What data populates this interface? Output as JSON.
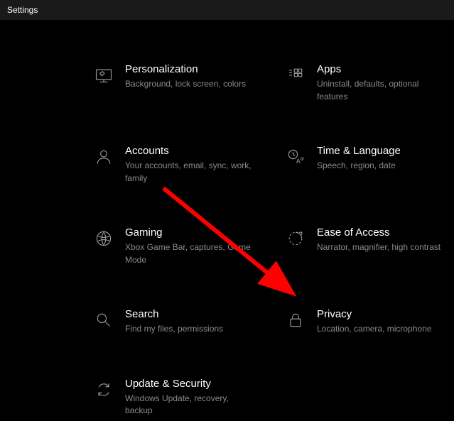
{
  "window": {
    "title": "Settings"
  },
  "items": [
    {
      "title": "Personalization",
      "desc": "Background, lock screen, colors"
    },
    {
      "title": "Apps",
      "desc": "Uninstall, defaults, optional features"
    },
    {
      "title": "Accounts",
      "desc": "Your accounts, email, sync, work, family"
    },
    {
      "title": "Time & Language",
      "desc": "Speech, region, date"
    },
    {
      "title": "Gaming",
      "desc": "Xbox Game Bar, captures, Game Mode"
    },
    {
      "title": "Ease of Access",
      "desc": "Narrator, magnifier, high contrast"
    },
    {
      "title": "Search",
      "desc": "Find my files, permissions"
    },
    {
      "title": "Privacy",
      "desc": "Location, camera, microphone"
    },
    {
      "title": "Update & Security",
      "desc": "Windows Update, recovery, backup"
    }
  ]
}
